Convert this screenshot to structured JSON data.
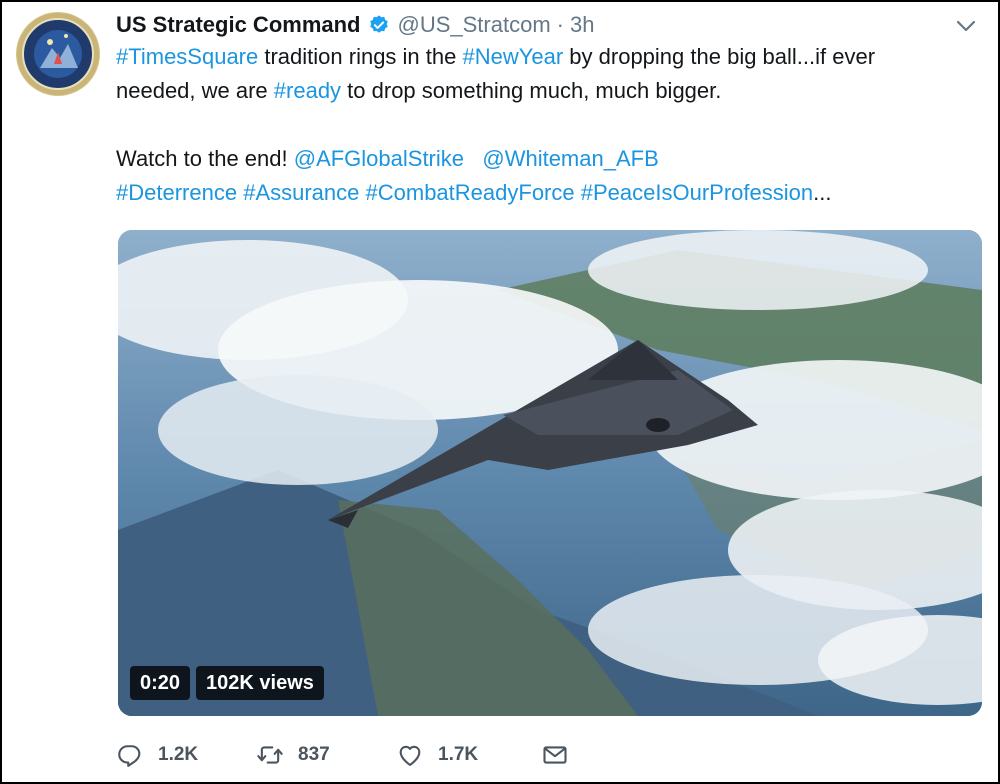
{
  "tweet": {
    "name": "US Strategic Command",
    "handle": "@US_Stratcom",
    "separator": "·",
    "time": "3h",
    "text": {
      "l1_tag1": "#TimesSquare",
      "l1_t1": " tradition rings in the ",
      "l1_tag2": "#NewYear",
      "l1_t2": " by dropping the big ball...if ever",
      "l2_t1": "needed, we are ",
      "l2_tag1": "#ready",
      "l2_t2": " to drop something much, much bigger.",
      "l3_t1": "Watch to the end! ",
      "l3_m1": "@AFGlobalStrike",
      "l3_gap": "   ",
      "l3_m2": "@Whiteman_AFB",
      "l4_tag1": "#Deterrence",
      "l4_tag2": "#Assurance",
      "l4_tag3": "#CombatReadyForce",
      "l4_tag4": "#PeaceIsOurProfession",
      "l4_ellipsis": "...",
      "space": " "
    },
    "media": {
      "duration": "0:20",
      "views": "102K views"
    },
    "actions": {
      "replies": "1.2K",
      "retweets": "837",
      "likes": "1.7K"
    },
    "colors": {
      "link": "#1b95e0",
      "verified": "#1da1f2",
      "muted": "#657786"
    },
    "icons": {
      "avatar": "stratcom-seal",
      "verified": "verified-badge-icon",
      "menu": "chevron-down-icon",
      "reply": "reply-icon",
      "retweet": "retweet-icon",
      "like": "heart-icon",
      "dm": "envelope-icon"
    }
  }
}
